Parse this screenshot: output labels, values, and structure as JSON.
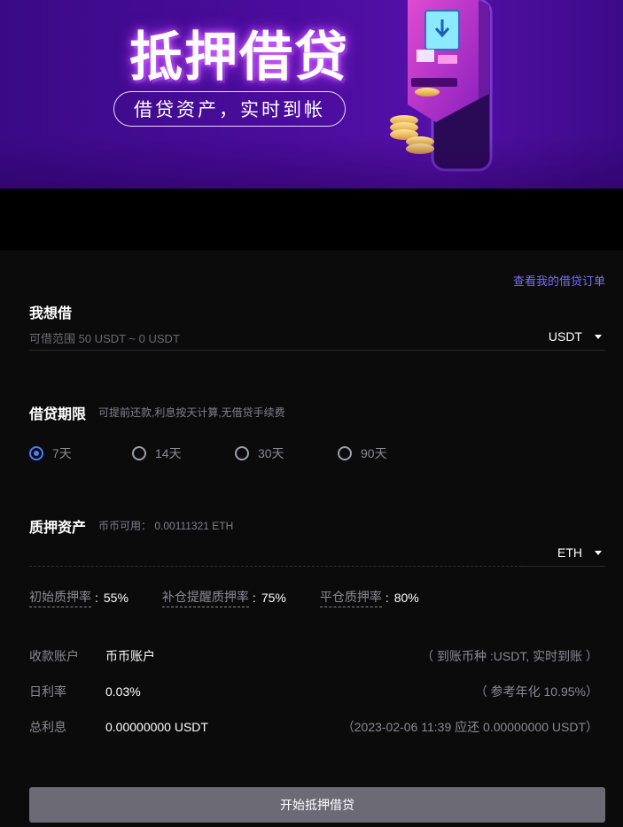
{
  "banner": {
    "title": "抵押借贷",
    "subtitle": "借贷资产，实时到帐"
  },
  "header": {
    "orders_link": "查看我的借贷订单"
  },
  "borrow": {
    "label": "我想借",
    "placeholder": "可借范围 50 USDT ~ 0 USDT",
    "currency": "USDT"
  },
  "term": {
    "label": "借贷期限",
    "hint": "可提前还款,利息按天计算,无借贷手续费",
    "options": [
      "7天",
      "14天",
      "30天",
      "90天"
    ],
    "selected": "7天"
  },
  "collateral": {
    "label": "质押资产",
    "available": "币币可用： 0.00111321 ETH",
    "currency": "ETH"
  },
  "ratios": [
    {
      "name": "初始质押率",
      "value": "55%"
    },
    {
      "name": "补仓提醒质押率",
      "value": "75%"
    },
    {
      "name": "平仓质押率",
      "value": "80%"
    }
  ],
  "info": {
    "account": {
      "key": "收款账户",
      "value": "币币账户",
      "note": "（ 到账币种 :USDT, 实时到账 ）"
    },
    "daily_rate": {
      "key": "日利率",
      "value": "0.03%",
      "note": "（ 参考年化 10.95%）"
    },
    "total_interest": {
      "key": "总利息",
      "value": "0.00000000 USDT",
      "note": "（2023-02-06 11:39 应还 0.00000000 USDT）"
    }
  },
  "submit_label": "开始抵押借贷",
  "colors": {
    "accent_link": "#7a6cff",
    "radio_checked": "#4a7dff",
    "button_bg": "#6c6a75",
    "panel_bg": "#0b0b0c",
    "banner_purple": "#4a0c9c"
  }
}
